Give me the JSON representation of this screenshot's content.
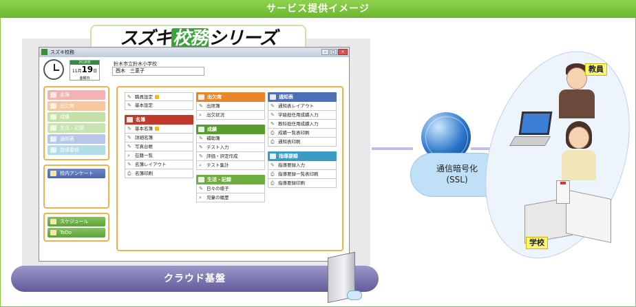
{
  "banner": {
    "title": "サービス提供イメージ"
  },
  "logo": {
    "pre": "スズキ",
    "mid": "校務",
    "post": "シリーズ"
  },
  "app": {
    "window_title": "スズキ校務",
    "calendar": {
      "year": "2018年",
      "month": "11月",
      "day": "19",
      "day_suffix": "日",
      "weekday": "金曜日"
    },
    "school_name": "鈴木市立鈴木小学校",
    "user_name": "西木　三恵子"
  },
  "sidebar": {
    "items": [
      {
        "label": "名簿",
        "color": "#f4b3b3"
      },
      {
        "label": "出欠席",
        "color": "#f6c8a0"
      },
      {
        "label": "成績",
        "color": "#c5e0a5"
      },
      {
        "label": "生活・記録",
        "color": "#c8e2b0"
      },
      {
        "label": "通知表",
        "color": "#b7c7ea"
      },
      {
        "label": "指導要録",
        "color": "#b2dce6"
      }
    ],
    "survey_label": "校内アンケート",
    "schedule_label": "スケジュール",
    "todo_label": "ToDo"
  },
  "menu": {
    "col1": [
      {
        "header": null,
        "items": [
          {
            "label": "職員設定",
            "lock": true,
            "icon": "✎"
          },
          {
            "label": "基本設定",
            "icon": "✎"
          }
        ]
      },
      {
        "header": {
          "label": "名簿",
          "color": "#c0392b"
        },
        "items": [
          {
            "label": "基本名簿",
            "lock": true,
            "icon": "✎"
          },
          {
            "label": "詳細名簿",
            "icon": "✎"
          },
          {
            "label": "写真台帳",
            "icon": "✎"
          },
          {
            "label": "在籍一覧",
            "icon": "⌕"
          },
          {
            "label": "名簿レイアウト",
            "icon": "✎"
          },
          {
            "label": "名簿印刷",
            "icon": "⎙"
          }
        ]
      }
    ],
    "col2": [
      {
        "header": {
          "label": "出欠席",
          "color": "#e8842a"
        },
        "items": [
          {
            "label": "出席簿",
            "icon": "✎"
          },
          {
            "label": "出欠状況",
            "icon": "⌕"
          }
        ]
      },
      {
        "header": {
          "label": "成績",
          "color": "#5a9d2f"
        },
        "items": [
          {
            "label": "補助簿",
            "icon": "✎"
          },
          {
            "label": "テスト入力",
            "icon": "✎"
          },
          {
            "label": "評価・評定作成",
            "icon": "✎"
          },
          {
            "label": "テスト集計",
            "icon": "⌕"
          }
        ]
      },
      {
        "header": {
          "label": "生活・記録",
          "color": "#6fae3f"
        },
        "items": [
          {
            "label": "日々の様子",
            "icon": "✎"
          },
          {
            "label": "児童の履歴",
            "icon": "⌕"
          }
        ]
      }
    ],
    "col3": [
      {
        "header": {
          "label": "通知表",
          "color": "#4d6fb8"
        },
        "items": [
          {
            "label": "通知表レイアウト",
            "icon": "✎"
          },
          {
            "label": "学級担任用成績入力",
            "icon": "✎"
          },
          {
            "label": "教科担任用成績入力",
            "icon": "✎"
          },
          {
            "label": "成績一覧表印刷",
            "icon": "⎙"
          },
          {
            "label": "通知表印刷",
            "icon": "⎙"
          }
        ]
      },
      {
        "header": {
          "label": "指導要録",
          "color": "#3a9bc4"
        },
        "items": [
          {
            "label": "指導要録入力",
            "icon": "✎"
          },
          {
            "label": "指導要録一覧表印刷",
            "icon": "⎙"
          },
          {
            "label": "指導要録印刷",
            "icon": "⎙"
          }
        ]
      }
    ]
  },
  "network": {
    "line1": "通信暗号化",
    "line2": "(SSL)"
  },
  "labels": {
    "teacher": "教員",
    "school": "学校",
    "cloud": "クラウド基盤"
  }
}
